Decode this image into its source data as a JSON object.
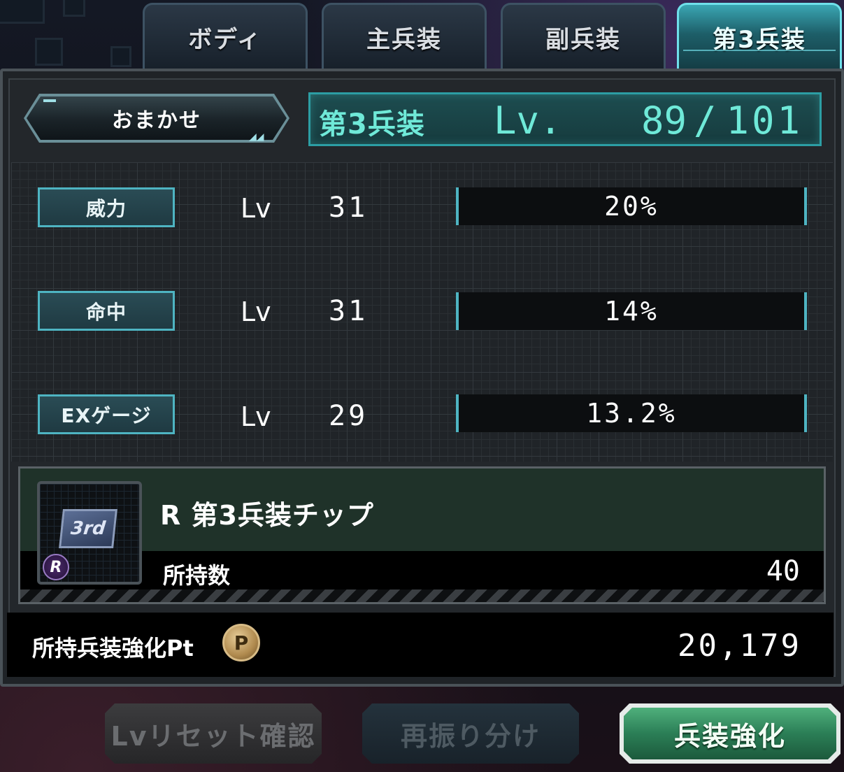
{
  "tabs": [
    {
      "label": "ボディ",
      "active": false
    },
    {
      "label": "主兵装",
      "active": false
    },
    {
      "label": "副兵装",
      "active": false
    },
    {
      "label": "第3兵装",
      "active": true
    }
  ],
  "auto_button": {
    "label": "おまかせ"
  },
  "level_header": {
    "category": "第3兵装",
    "lv_prefix": "Lv.",
    "current": "89",
    "separator": "/",
    "max": "101"
  },
  "stats": [
    {
      "name": "威力",
      "lv_label": "Lv",
      "level": "31",
      "bonus": "20%"
    },
    {
      "name": "命中",
      "lv_label": "Lv",
      "level": "31",
      "bonus": "14%"
    },
    {
      "name": "EXゲージ",
      "lv_label": "Lv",
      "level": "29",
      "bonus": "13.2%"
    }
  ],
  "chip": {
    "icon_text": "3rd",
    "rarity_badge": "R",
    "name": "R 第3兵装チップ",
    "owned_label": "所持数",
    "owned_value": "40"
  },
  "points": {
    "label": "所持兵装強化Pt",
    "coin_glyph": "P",
    "value": "20,179"
  },
  "buttons": {
    "reset": "Lvリセット確認",
    "reallocate": "再振り分け",
    "enhance": "兵装強化"
  },
  "colors": {
    "accent_cyan": "#6fe9d8",
    "active_tab": "#3aa6b3",
    "enhance_green": "#2b7e56"
  }
}
